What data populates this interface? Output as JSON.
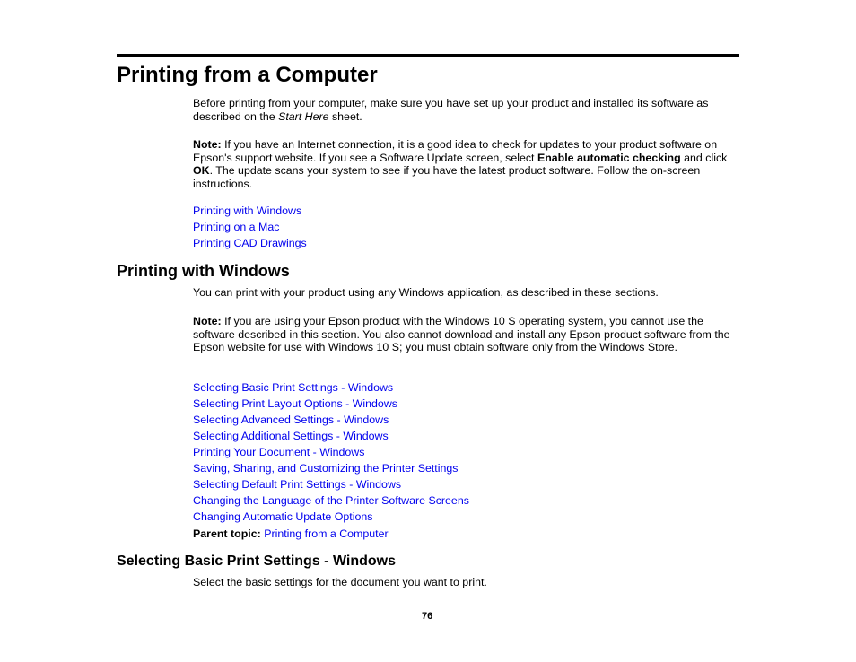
{
  "page": {
    "title": "Printing from a Computer",
    "intro": {
      "before": "Before printing from your computer, make sure you have set up your product and installed its software as described on the ",
      "italic": "Start Here",
      "after": " sheet."
    },
    "note1": {
      "label": "Note:",
      "text1": " If you have an Internet connection, it is a good idea to check for updates to your product software on Epson's support website. If you see a Software Update screen, select ",
      "bold1": "Enable automatic checking",
      "text2": " and click ",
      "bold2": "OK",
      "text3": ". The update scans your system to see if you have the latest product software. Follow the on-screen instructions."
    },
    "top_links": [
      "Printing with Windows",
      "Printing on a Mac",
      "Printing CAD Drawings"
    ],
    "section": {
      "heading": "Printing with Windows",
      "intro": "You can print with your product using any Windows application, as described in these sections.",
      "note": {
        "label": "Note:",
        "text": " If you are using your Epson product with the Windows 10 S operating system, you cannot use the software described in this section. You also cannot download and install any Epson product software from the Epson website for use with Windows 10 S; you must obtain software only from the Windows Store."
      },
      "links": [
        "Selecting Basic Print Settings - Windows",
        "Selecting Print Layout Options - Windows",
        "Selecting Advanced Settings - Windows",
        "Selecting Additional Settings - Windows",
        "Printing Your Document - Windows",
        "Saving, Sharing, and Customizing the Printer Settings",
        "Selecting Default Print Settings - Windows",
        "Changing the Language of the Printer Software Screens",
        "Changing Automatic Update Options"
      ],
      "parent_label": "Parent topic:",
      "parent_link": "Printing from a Computer"
    },
    "subsection": {
      "heading": "Selecting Basic Print Settings - Windows",
      "text": "Select the basic settings for the document you want to print."
    },
    "page_number": "76"
  },
  "colors": {
    "link": "#0000ee",
    "text": "#000000"
  }
}
